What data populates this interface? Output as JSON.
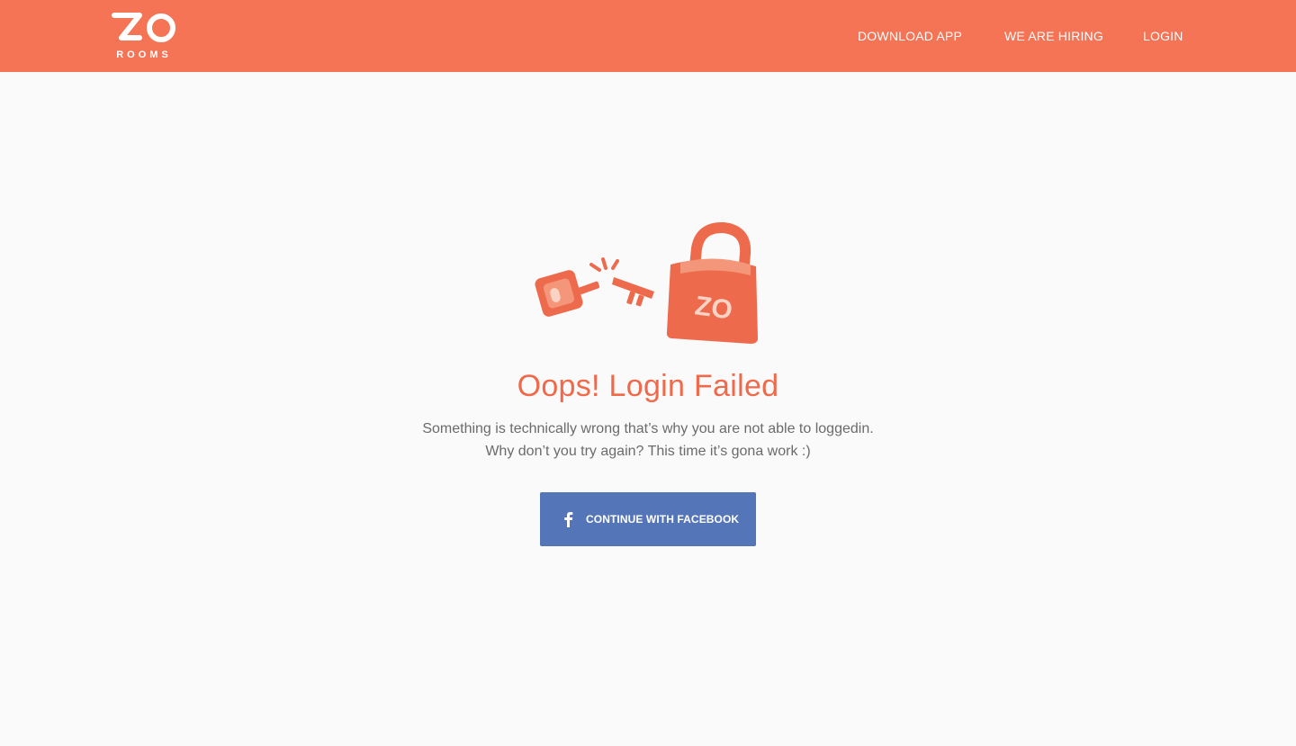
{
  "header": {
    "logo_text_top": "ZO",
    "logo_text_bottom": "ROOMS",
    "nav": {
      "download_app": "DOWNLOAD APP",
      "hiring": "WE ARE HIRING",
      "login": "LOGIN"
    }
  },
  "illustration": {
    "lock_text": "ZO"
  },
  "main": {
    "title": "Oops! Login Failed",
    "message_line1": "Something is technically wrong that’s why you are not able to loggedin.",
    "message_line2": "Why don’t you try again? This time it’s gona work :)",
    "facebook_button_label": "CONTINUE WITH FACEBOOK"
  },
  "colors": {
    "brand": "#f47455",
    "title": "#f0694b",
    "facebook": "#5575b9",
    "background": "#fafafa"
  },
  "icons": {
    "logo": "zo-rooms-logo",
    "illustration": "broken-key-and-padlock",
    "facebook": "facebook-icon"
  }
}
